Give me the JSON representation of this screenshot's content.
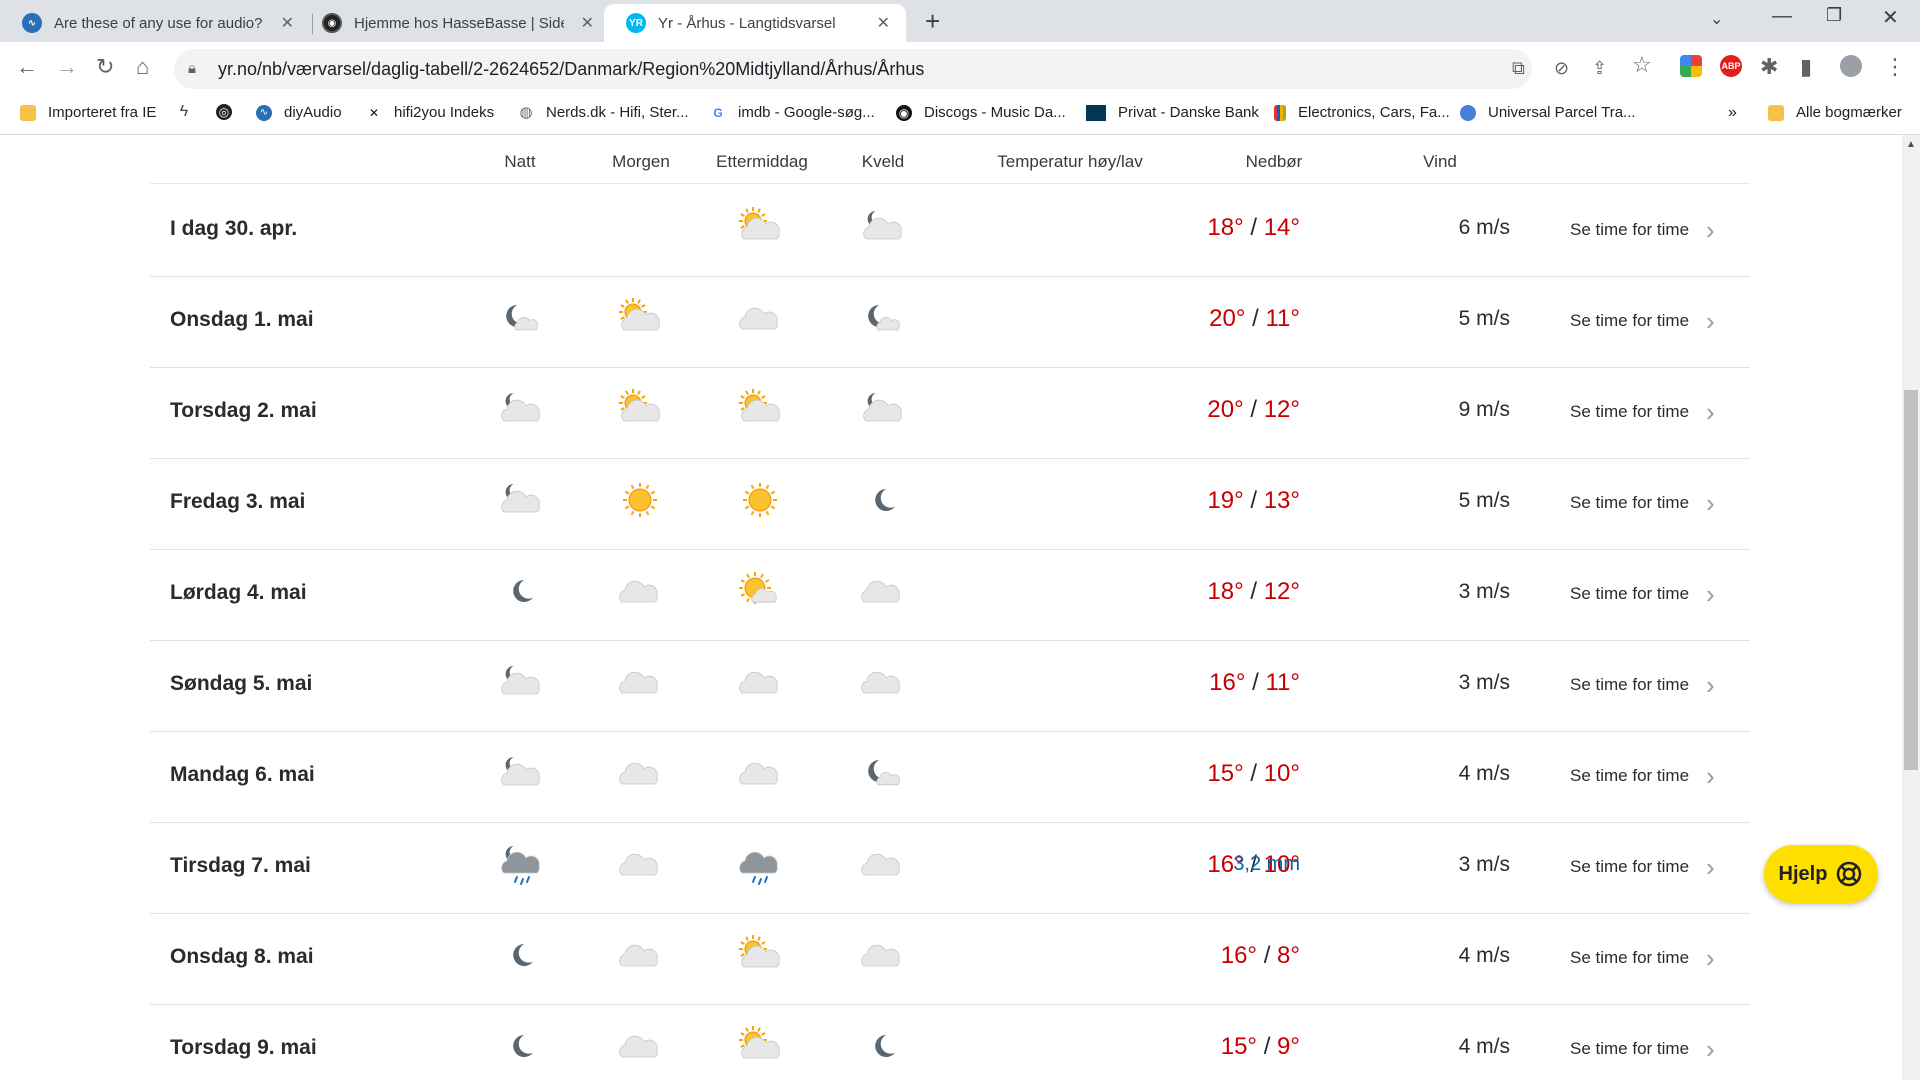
{
  "browser": {
    "tabs": [
      {
        "title": "Are these of any use for audio? |",
        "icon": "diyaudio-icon",
        "close": "✕"
      },
      {
        "title": "Hjemme hos HasseBasse | Side 8",
        "icon": "forum-icon",
        "close": "✕"
      },
      {
        "title": "Yr - Århus - Langtidsvarsel",
        "icon": "yr-icon",
        "close": "✕",
        "active": true
      }
    ],
    "new_tab": "+",
    "url": "yr.no/nb/værvarsel/daglig-tabell/2-2624652/Danmark/Region%20Midtjylland/Århus/Århus",
    "bookmarks": [
      {
        "label": "Importeret fra IE",
        "icon": "folder-icon"
      },
      {
        "label": "",
        "icon": "bolt-icon"
      },
      {
        "label": "",
        "icon": "vinyl-icon"
      },
      {
        "label": "diyAudio",
        "icon": "diyaudio-icon"
      },
      {
        "label": "hifi2you Indeks",
        "icon": "x-logo-icon"
      },
      {
        "label": "Nerds.dk - Hifi, Ster...",
        "icon": "globe-icon"
      },
      {
        "label": "imdb - Google-søg...",
        "icon": "google-icon"
      },
      {
        "label": "Discogs - Music Da...",
        "icon": "discogs-icon"
      },
      {
        "label": "Privat - Danske Bank",
        "icon": "bank-icon"
      },
      {
        "label": "Electronics, Cars, Fa...",
        "icon": "ebay-icon"
      },
      {
        "label": "Universal Parcel Tra...",
        "icon": "globe-icon"
      }
    ],
    "bookmarks_overflow": "»",
    "all_bookmarks": "Alle bogmærker",
    "ext_abp": "ABP"
  },
  "forecast": {
    "headers": {
      "night": "Natt",
      "morning": "Morgen",
      "afternoon": "Ettermiddag",
      "evening": "Kveld",
      "temp": "Temperatur høy/lav",
      "precip": "Nedbør",
      "wind": "Vind"
    },
    "rows": [
      {
        "day": "I dag 30. apr.",
        "icons": [
          "",
          "",
          "partly-cloudy-day",
          "partly-cloudy-night"
        ],
        "high": "18°",
        "low": "14°",
        "precip": "",
        "wind": "6 m/s",
        "link": "Se time for time"
      },
      {
        "day": "Onsdag 1. mai",
        "icons": [
          "fair-night",
          "partly-cloudy-day",
          "cloudy",
          "fair-night"
        ],
        "high": "20°",
        "low": "11°",
        "precip": "",
        "wind": "5 m/s",
        "link": "Se time for time"
      },
      {
        "day": "Torsdag 2. mai",
        "icons": [
          "partly-cloudy-night",
          "partly-cloudy-day",
          "partly-cloudy-day",
          "partly-cloudy-night"
        ],
        "high": "20°",
        "low": "12°",
        "precip": "",
        "wind": "9 m/s",
        "link": "Se time for time"
      },
      {
        "day": "Fredag 3. mai",
        "icons": [
          "partly-cloudy-night",
          "clear-day",
          "clear-day",
          "clear-night"
        ],
        "high": "19°",
        "low": "13°",
        "precip": "",
        "wind": "5 m/s",
        "link": "Se time for time"
      },
      {
        "day": "Lørdag 4. mai",
        "icons": [
          "clear-night",
          "cloudy",
          "fair-day",
          "cloudy"
        ],
        "high": "18°",
        "low": "12°",
        "precip": "",
        "wind": "3 m/s",
        "link": "Se time for time"
      },
      {
        "day": "Søndag 5. mai",
        "icons": [
          "partly-cloudy-night",
          "cloudy",
          "cloudy",
          "cloudy"
        ],
        "high": "16°",
        "low": "11°",
        "precip": "",
        "wind": "3 m/s",
        "link": "Se time for time"
      },
      {
        "day": "Mandag 6. mai",
        "icons": [
          "partly-cloudy-night",
          "cloudy",
          "cloudy",
          "fair-night"
        ],
        "high": "15°",
        "low": "10°",
        "precip": "",
        "wind": "4 m/s",
        "link": "Se time for time"
      },
      {
        "day": "Tirsdag 7. mai",
        "icons": [
          "rain-showers-night",
          "cloudy",
          "rain",
          "cloudy"
        ],
        "high": "16°",
        "low": "10°",
        "precip": "3,2 mm",
        "wind": "3 m/s",
        "link": "Se time for time"
      },
      {
        "day": "Onsdag 8. mai",
        "icons": [
          "clear-night",
          "cloudy",
          "partly-cloudy-day",
          "cloudy"
        ],
        "high": "16°",
        "low": "8°",
        "precip": "",
        "wind": "4 m/s",
        "link": "Se time for time"
      },
      {
        "day": "Torsdag 9. mai",
        "icons": [
          "clear-night",
          "cloudy",
          "partly-cloudy-day",
          "clear-night"
        ],
        "high": "15°",
        "low": "9°",
        "precip": "",
        "wind": "4 m/s",
        "link": "Se time for time"
      }
    ],
    "help_label": "Hjelp"
  },
  "colors": {
    "temp_high": "#c60000",
    "precip": "#0063b0",
    "help_button": "#ffdf00",
    "tab_strip": "#dee1e6"
  }
}
